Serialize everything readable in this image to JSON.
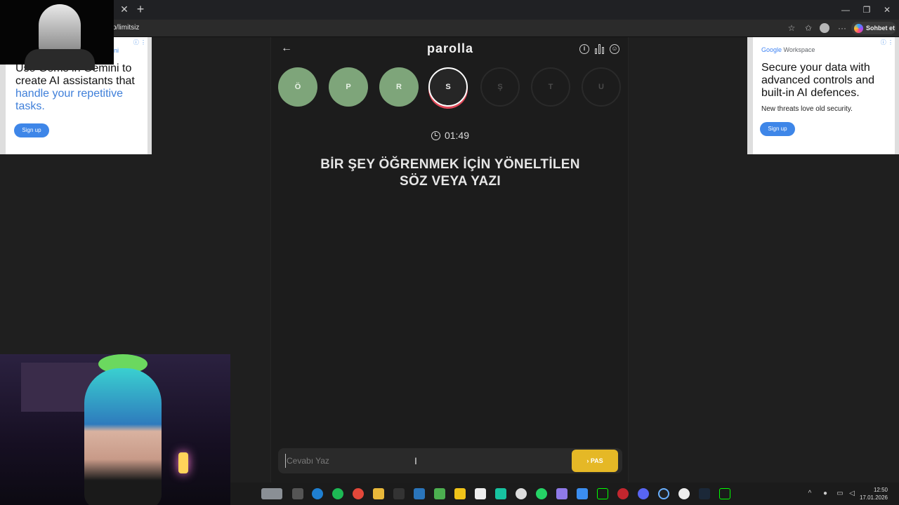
{
  "browser": {
    "url": "p/limitsiz",
    "chat_button": "Sohbet et"
  },
  "ads": {
    "left": {
      "tag": "ini",
      "headline_start": "Use Gems in Gemini to create AI assistants that ",
      "headline_highlight": "handle your repetitive tasks.",
      "button": "Sign up"
    },
    "right": {
      "brand_google": "Google",
      "brand_product": " Workspace",
      "headline": "Secure your data with advanced controls and built-in AI defences.",
      "subtext": "New threats love old security.",
      "button": "Sign up"
    }
  },
  "game": {
    "brand": "parolla",
    "letters": [
      {
        "char": "Ö",
        "state": "done"
      },
      {
        "char": "P",
        "state": "done"
      },
      {
        "char": "R",
        "state": "done"
      },
      {
        "char": "S",
        "state": "active"
      },
      {
        "char": "Ş",
        "state": "pending"
      },
      {
        "char": "T",
        "state": "pending"
      },
      {
        "char": "U",
        "state": "pending"
      }
    ],
    "timer": "01:49",
    "question": "BİR ŞEY ÖĞRENMEK İÇİN YÖNELTİLEN SÖZ VEYA YAZI",
    "answer_placeholder": "Cevabı Yaz",
    "pass_button": "PAS"
  },
  "taskbar": {
    "time": "12:50",
    "date": "17.01.2026"
  },
  "colors": {
    "done": "#7ea57a",
    "pass": "#e5b826",
    "active_ring": "#e04858"
  }
}
